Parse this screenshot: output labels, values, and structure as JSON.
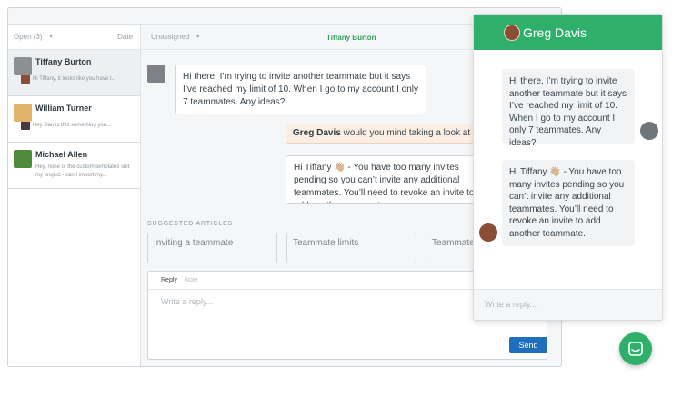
{
  "inbox": {
    "list_header": {
      "filter": "Open (3)",
      "sort": "Date"
    },
    "conversations": [
      {
        "name": "Tiffany Burton",
        "preview": "Hi Tiffany, it looks like you have t..."
      },
      {
        "name": "William Turner",
        "preview": "Hey Dan is this something you..."
      },
      {
        "name": "Michael Allen",
        "preview": "Hey, none of the custom templates suit my project - can I import my..."
      }
    ],
    "conv_header": {
      "assignee": "Unassigned",
      "customer": "Tiffany Burton"
    },
    "messages": {
      "customer": "Hi there, I’m trying to invite another teammate but it says I’ve reached my limit of 10. When I go to my account I only 7 teammates. Any ideas?",
      "note_name": "Greg Davis",
      "note_text": "would you mind taking a look at th",
      "agent": "Hi Tiffany 👋🏼 - You have too many invites pending so you can’t invite any additional teammates. You’ll need to revoke an invite to add another teammate."
    },
    "suggested": {
      "label": "SUGGESTED ARTICLES",
      "articles": [
        "Inviting a teammate",
        "Teammate limits",
        "Teammate"
      ]
    },
    "reply": {
      "tab_reply": "Reply",
      "tab_note": "Note",
      "placeholder": "Write a reply...",
      "send_label": "Send"
    }
  },
  "widget": {
    "agent_name": "Greg Davis",
    "messages": [
      "Hi there, I’m trying to invite another teammate but it says I’ve reached my limit of 10. When I go to my account I only 7 teammates. Any ideas?",
      "Hi Tiffany 👋🏼 - You have too many invites pending so you can’t invite any additional teammates. You’ll need to revoke an invite to add another teammate."
    ],
    "placeholder": "Write a reply..."
  },
  "colors": {
    "accent_green": "#2eb06b",
    "send_blue": "#1f6fbd",
    "note_bg": "#fbefe4"
  }
}
